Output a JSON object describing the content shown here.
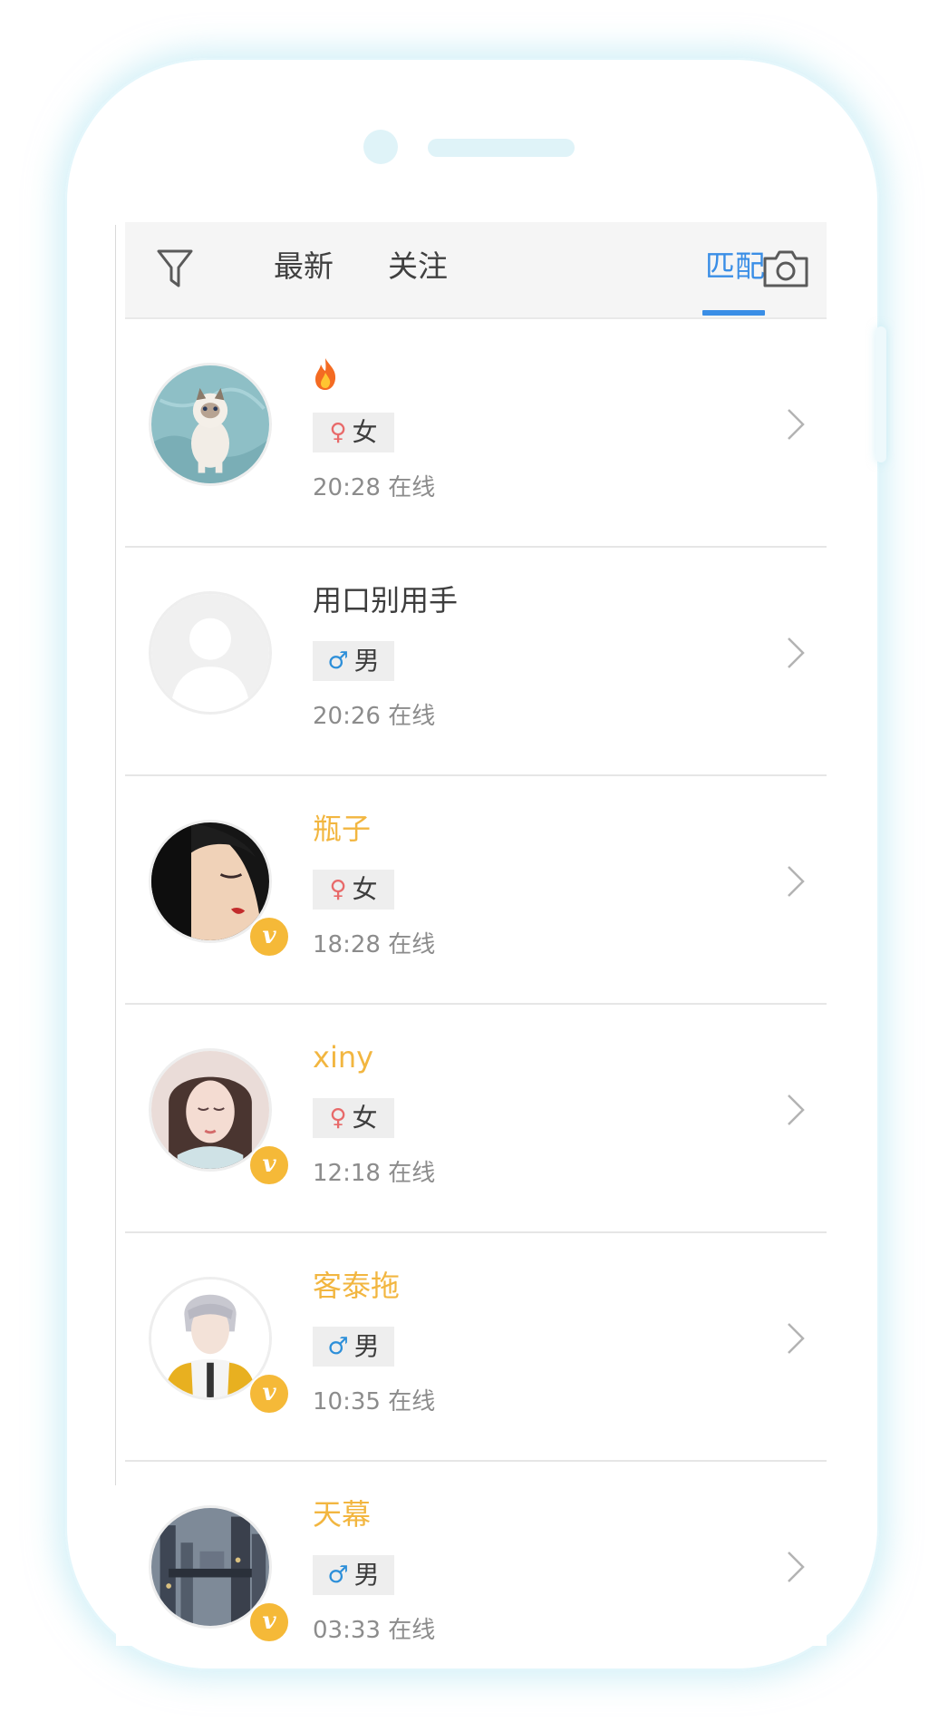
{
  "tabs": [
    {
      "label": "最新",
      "active": false
    },
    {
      "label": "关注",
      "active": false
    },
    {
      "label": "匹配",
      "active": true
    }
  ],
  "icons": {
    "filter": "filter-icon",
    "camera": "camera-icon",
    "chevron": "chevron-right-icon",
    "vip": "vip-badge-icon"
  },
  "colors": {
    "active_tab": "#3a8ee6",
    "vip_name": "#f2b640",
    "female": "#e86a6a",
    "male": "#2d8fd9"
  },
  "users": [
    {
      "name": "",
      "name_icon": "fire-icon",
      "vip": false,
      "gender_symbol": "♀",
      "gender": "女",
      "gender_type": "female",
      "online": "20:28 在线",
      "avatar": "cat"
    },
    {
      "name": "用口别用手",
      "vip": false,
      "gender_symbol": "♂",
      "gender": "男",
      "gender_type": "male",
      "online": "20:26 在线",
      "avatar": "default"
    },
    {
      "name": "瓶子",
      "vip": true,
      "vip_badge": "v",
      "gender_symbol": "♀",
      "gender": "女",
      "gender_type": "female",
      "online": "18:28 在线",
      "avatar": "painted-woman"
    },
    {
      "name": "xiny",
      "vip": true,
      "vip_badge": "v",
      "gender_symbol": "♀",
      "gender": "女",
      "gender_type": "female",
      "online": "12:18 在线",
      "avatar": "girl-portrait"
    },
    {
      "name": "客泰拖",
      "vip": true,
      "vip_badge": "v",
      "gender_symbol": "♂",
      "gender": "男",
      "gender_type": "male",
      "online": "10:35 在线",
      "avatar": "anime-boy"
    },
    {
      "name": "天幕",
      "vip": true,
      "vip_badge": "v",
      "gender_symbol": "♂",
      "gender": "男",
      "gender_type": "male",
      "online": "03:33 在线",
      "avatar": "city"
    }
  ]
}
